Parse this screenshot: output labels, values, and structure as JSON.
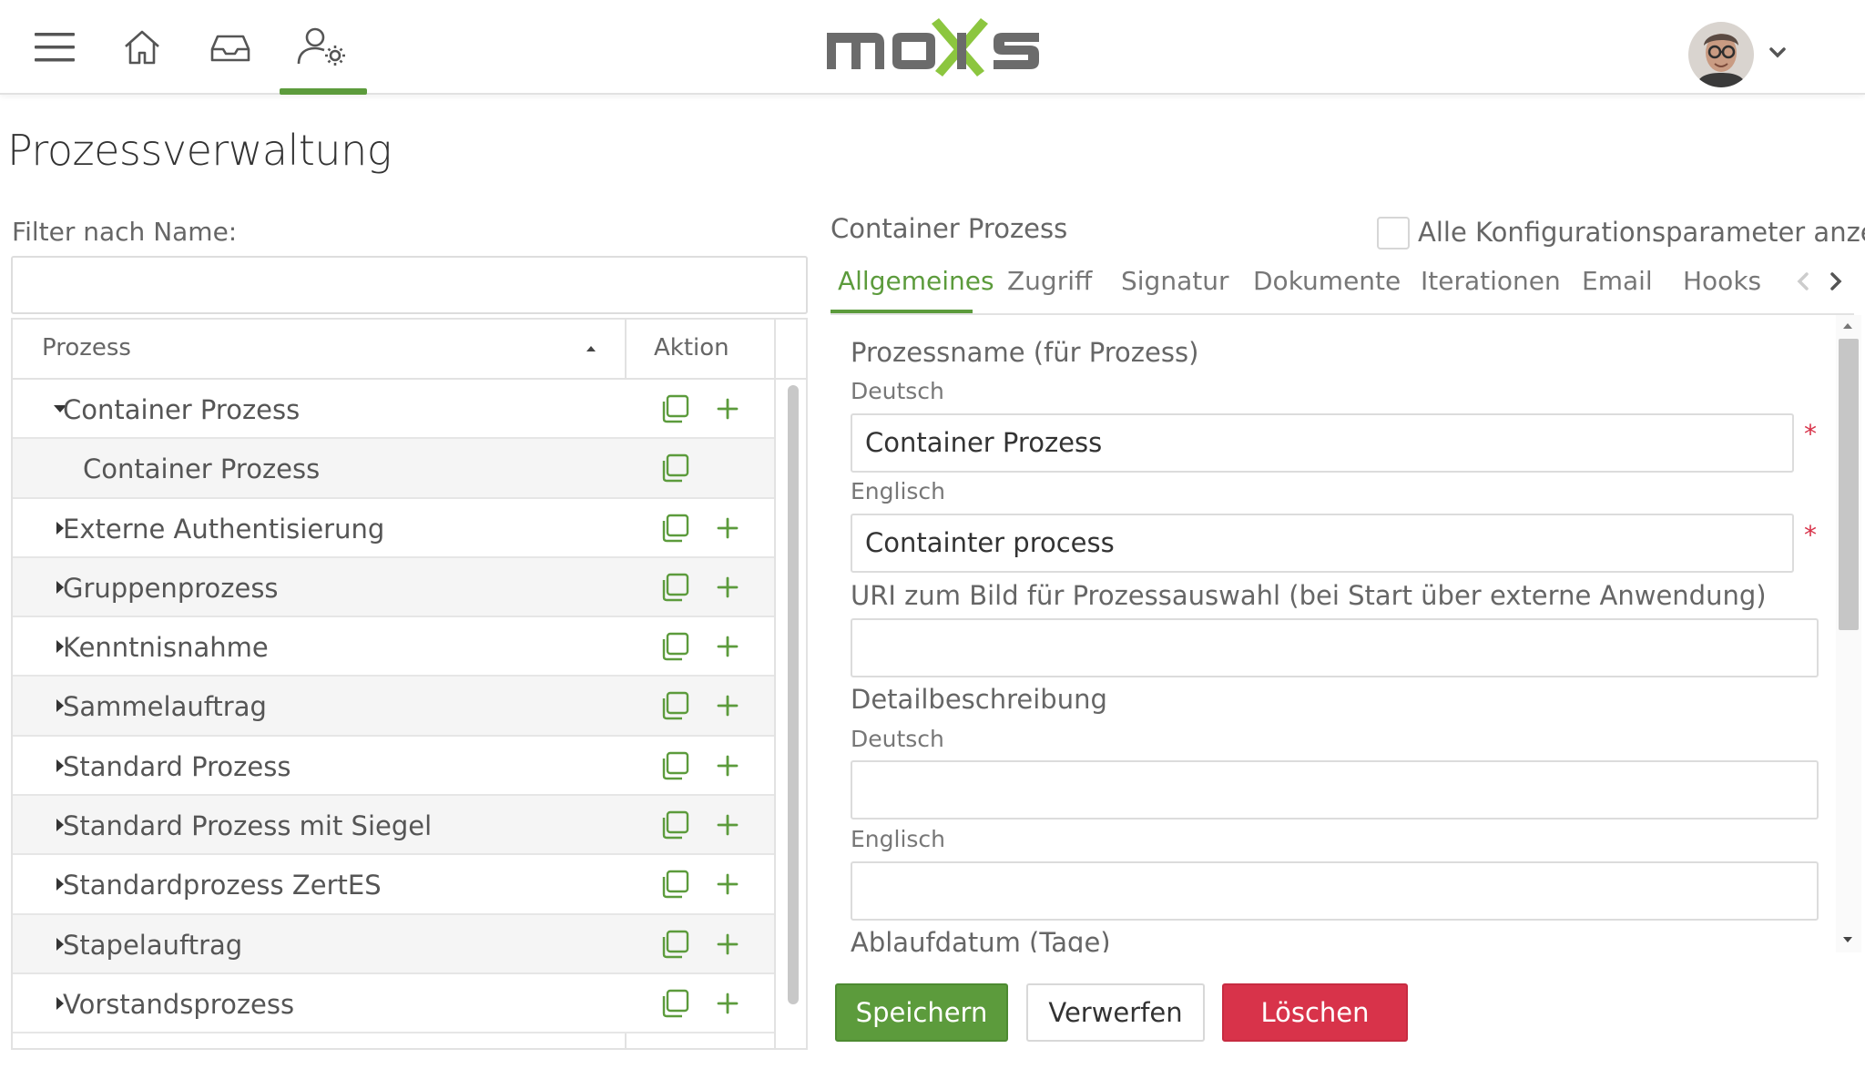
{
  "app": {
    "logo_text": "moxis",
    "colors": {
      "accent": "#5c9b3c",
      "danger": "#d8334a",
      "logo_gray": "#6b6b6b",
      "logo_green": "#8cc63f"
    }
  },
  "topnav": {
    "icons": [
      "menu-icon",
      "home-icon",
      "inbox-icon",
      "user-settings-icon"
    ],
    "active": "user-settings-icon"
  },
  "page": {
    "title": "Prozessverwaltung"
  },
  "filter": {
    "label": "Filter nach Name:",
    "value": "",
    "placeholder": ""
  },
  "tree": {
    "col_process": "Prozess",
    "col_action": "Aktion",
    "rows": [
      {
        "label": "Container Prozess",
        "level": 0,
        "expanded": true,
        "has_add": true
      },
      {
        "label": "Container Prozess",
        "level": 1,
        "expanded": false,
        "has_add": false
      },
      {
        "label": "Externe Authentisierung",
        "level": 0,
        "expanded": false,
        "has_add": true
      },
      {
        "label": "Gruppenprozess",
        "level": 0,
        "expanded": false,
        "has_add": true
      },
      {
        "label": "Kenntnisnahme",
        "level": 0,
        "expanded": false,
        "has_add": true
      },
      {
        "label": "Sammelauftrag",
        "level": 0,
        "expanded": false,
        "has_add": true
      },
      {
        "label": "Standard Prozess",
        "level": 0,
        "expanded": false,
        "has_add": true
      },
      {
        "label": "Standard Prozess mit Siegel",
        "level": 0,
        "expanded": false,
        "has_add": true
      },
      {
        "label": "Standardprozess ZertES",
        "level": 0,
        "expanded": false,
        "has_add": true
      },
      {
        "label": "Stapelauftrag",
        "level": 0,
        "expanded": false,
        "has_add": true
      },
      {
        "label": "Vorstandsprozess",
        "level": 0,
        "expanded": false,
        "has_add": true
      }
    ]
  },
  "detail": {
    "title": "Container Prozess",
    "show_all_params_label": "Alle Konfigurationsparameter anzeigen",
    "show_all_params_checked": false,
    "tabs": [
      "Allgemeines",
      "Zugriff",
      "Signatur",
      "Dokumente",
      "Iterationen",
      "Email",
      "Hooks"
    ],
    "active_tab": "Allgemeines",
    "form": {
      "process_name_label": "Prozessname (für Prozess)",
      "german_label": "Deutsch",
      "english_label": "Englisch",
      "name_de": "Container Prozess",
      "name_en": "Containter process",
      "required_mark": "*",
      "uri_label": "URI zum Bild für Prozessauswahl (bei Start über externe Anwendung)",
      "uri_value": "",
      "description_label": "Detailbeschreibung",
      "desc_de": "",
      "desc_en": "",
      "expiry_label": "Ablaufdatum (Tage)"
    },
    "buttons": {
      "save": "Speichern",
      "discard": "Verwerfen",
      "delete": "Löschen"
    }
  }
}
